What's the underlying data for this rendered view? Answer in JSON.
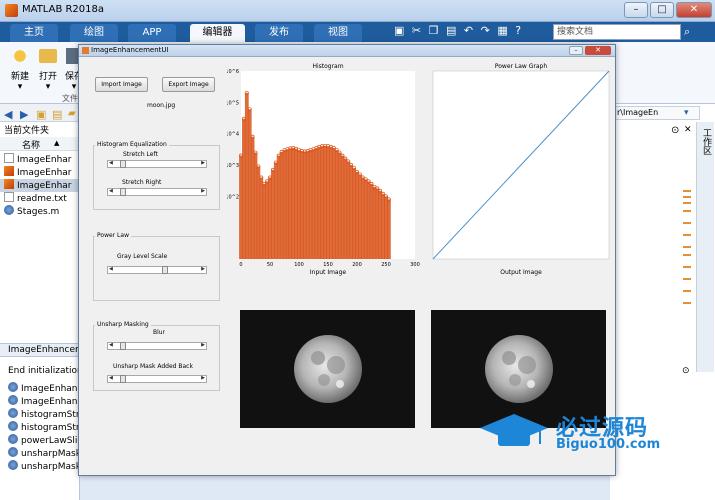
{
  "matlab": {
    "title": "MATLAB R2018a",
    "tabs": [
      "主页",
      "绘图",
      "APP",
      "编辑器",
      "发布",
      "视图"
    ],
    "active_tab": "编辑器",
    "search_placeholder": "搜索文档",
    "ribbon": {
      "new_label": "新建",
      "open_label": "打开",
      "save_label": "保存",
      "section_label": "文件"
    }
  },
  "current_folder": {
    "header": "当前文件夹",
    "column_name": "名称",
    "sort_indicator": "▲",
    "files": [
      {
        "name": "ImageEnhar",
        "type": "fig"
      },
      {
        "name": "ImageEnhar",
        "type": "m"
      },
      {
        "name": "ImageEnhar",
        "type": "mlapp",
        "selected": true
      },
      {
        "name": "readme.txt",
        "type": "txt"
      },
      {
        "name": "Stages.m",
        "type": "m"
      }
    ]
  },
  "command_window": {
    "tab_label": "ImageEnhanceme",
    "first_line": "End initialization c",
    "items": [
      "ImageEnhanc",
      "ImageEnhanc",
      "histogramStre",
      "histogramStre",
      "powerLawSlid",
      "unsharpMask",
      "unsharpMask"
    ]
  },
  "right_panel": {
    "path_text": "r\\ImageEn",
    "vertical_label": "工作区"
  },
  "app": {
    "title": "ImageEnhancementUI",
    "import_label": "Import Image",
    "export_label": "Export Image",
    "image_name": "moon.jpg",
    "hist_panel": {
      "title": "Histogram Equalization",
      "stretch_left": "Stretch Left",
      "stretch_right": "Stretch Right"
    },
    "power_panel": {
      "title": "Power Law",
      "gray_label": "Gray Level Scale"
    },
    "unsharp_panel": {
      "title": "Unsharp Masking",
      "blur_label": "Blur",
      "added_back_label": "Unsharp Mask Added Back"
    },
    "slider_values": {
      "stretch_left": 0.05,
      "stretch_right": 0.05,
      "gray_level": 0.6,
      "blur": 0.05,
      "added_back": 0.05
    }
  },
  "chart_data": [
    {
      "type": "bar",
      "title": "Histogram",
      "xlabel": "Input Image",
      "ylabel": "",
      "xlim": [
        0,
        300
      ],
      "ylim_log": [
        1,
        1000000
      ],
      "yscale": "log",
      "xticks": [
        0,
        50,
        100,
        150,
        200,
        250,
        300
      ],
      "ytick_labels": [
        "10^2",
        "10^3",
        "10^4",
        "10^5",
        "10^6"
      ],
      "color": "#d9541a",
      "series": [
        {
          "x": [
            0,
            5,
            10,
            15,
            20,
            25,
            30,
            35,
            40,
            45,
            50,
            55,
            60,
            65,
            70,
            75,
            80,
            85,
            90,
            95,
            100,
            105,
            110,
            115,
            120,
            125,
            130,
            135,
            140,
            145,
            150,
            155,
            160,
            165,
            170,
            175,
            180,
            185,
            190,
            195,
            200,
            205,
            210,
            215,
            220,
            225,
            230,
            235,
            240,
            245,
            250,
            255
          ],
          "y": [
            2000,
            30000,
            200000,
            60000,
            8000,
            2500,
            900,
            400,
            250,
            300,
            400,
            700,
            1200,
            2000,
            2600,
            3000,
            3200,
            3400,
            3500,
            3300,
            3000,
            2800,
            2700,
            2800,
            3000,
            3200,
            3500,
            3800,
            4000,
            4100,
            4000,
            3800,
            3500,
            3000,
            2500,
            2000,
            1600,
            1300,
            1000,
            800,
            600,
            500,
            400,
            350,
            300,
            250,
            200,
            180,
            150,
            120,
            100,
            80
          ]
        }
      ]
    },
    {
      "type": "line",
      "title": "Power Law Graph",
      "xlabel": "Output Image",
      "ylabel": "",
      "xlim": [
        0,
        1
      ],
      "ylim": [
        0,
        1
      ],
      "color": "#4a90c8",
      "series": [
        {
          "x": [
            0,
            1
          ],
          "y": [
            0,
            1
          ]
        }
      ]
    }
  ],
  "watermark": {
    "text": "必过源码",
    "url": "Biguo100.com"
  }
}
